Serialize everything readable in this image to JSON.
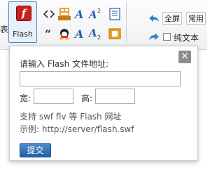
{
  "toolbar": {
    "left_cut_text": "表",
    "flash_label": "Flash",
    "flash_glyph": "f",
    "fullscreen_label": "全屏",
    "common_label": "常用",
    "plaintext_label": "纯文本",
    "icons": [
      "code-icon",
      "quote-icon",
      "free-badge-icon",
      "font-icon",
      "font-size-icon",
      "superscript-icon",
      "subscript-icon",
      "emoticon-icon",
      "text-box-icon",
      "image-box-icon",
      "undo-icon",
      "redo-icon"
    ]
  },
  "dialog": {
    "prompt": "请输入 Flash 文件地址:",
    "url_value": "",
    "width_label": "宽:",
    "width_value": "",
    "height_label": "高:",
    "height_value": "",
    "hint_formats": "支持 swf flv 等 Flash 网址",
    "hint_example": "示例: http://server/flash.swf",
    "submit_label": "提交",
    "close_glyph": "✕"
  },
  "colors": {
    "accent": "#2561a8",
    "flash_red": "#c8201c"
  }
}
